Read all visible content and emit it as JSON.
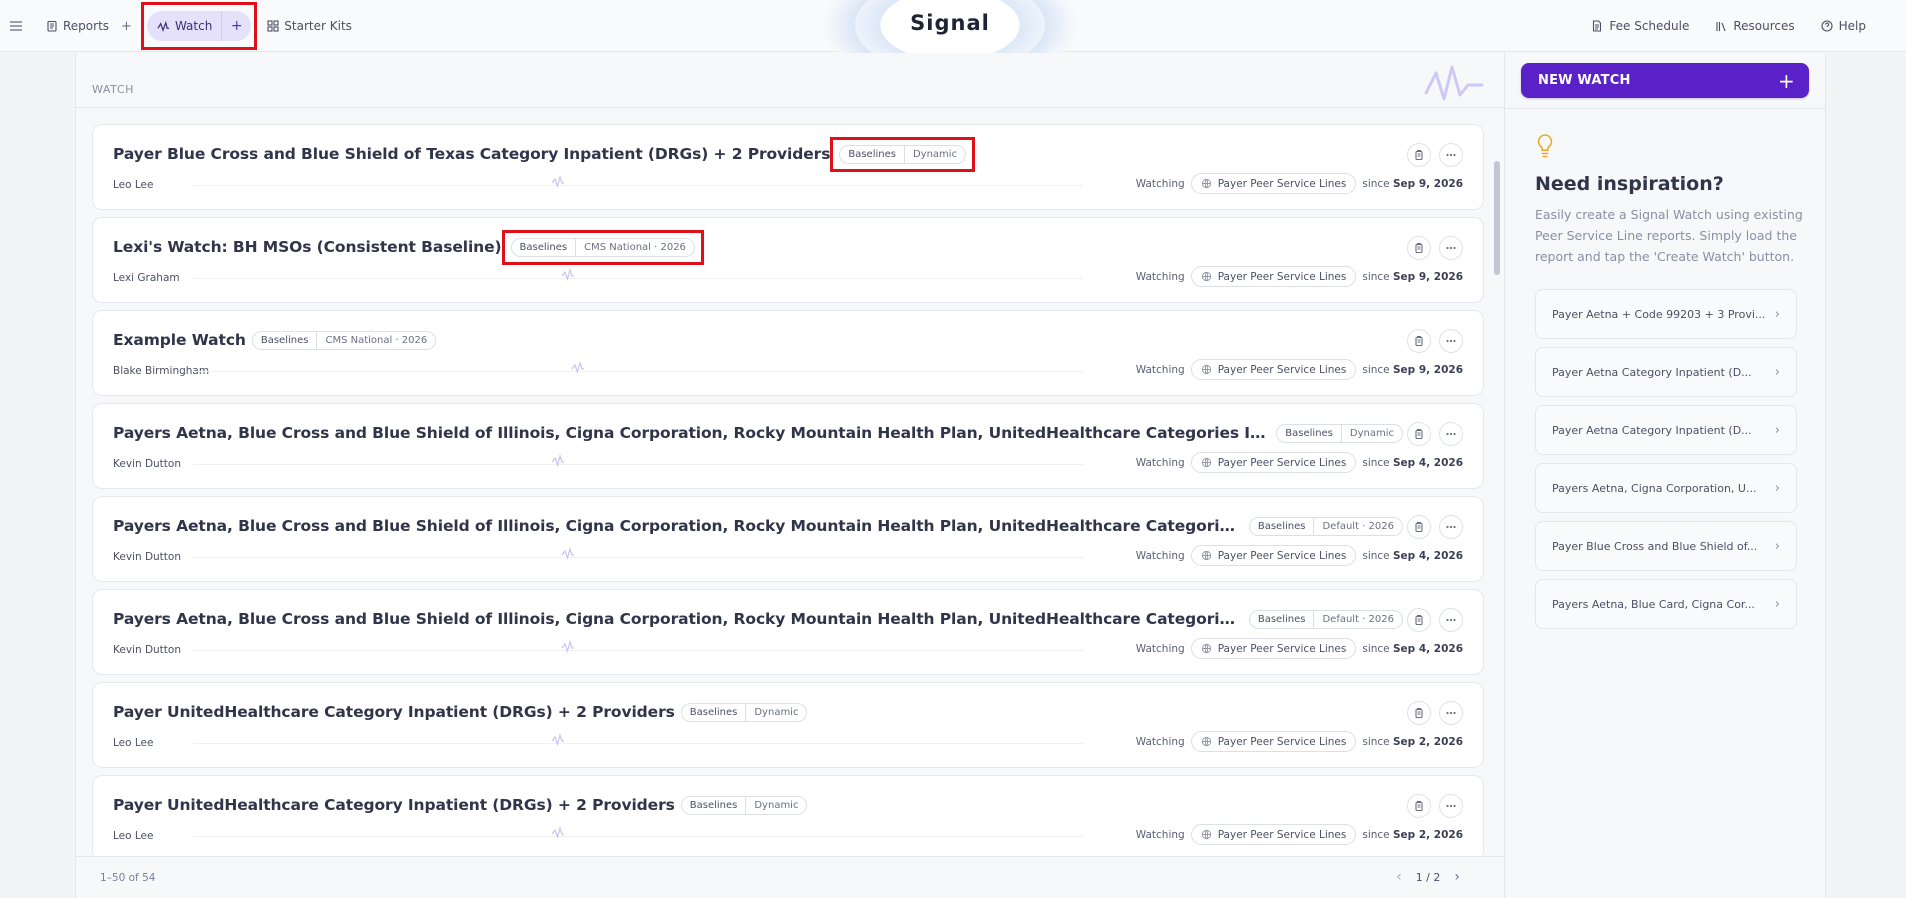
{
  "topbar": {
    "brand": "Signal",
    "reports_label": "Reports",
    "add_label": "+",
    "watch_label": "Watch",
    "starter_kits_label": "Starter Kits",
    "fee_schedule_label": "Fee Schedule",
    "resources_label": "Resources",
    "help_label": "Help"
  },
  "main": {
    "section_title": "WATCH",
    "cards": [
      {
        "title": "Payer Blue Cross and Blue Shield of Texas Category Inpatient (DRGs) + 2 Providers",
        "tag_a": "Baselines",
        "tag_b": "Dynamic",
        "owner": "Leo Lee",
        "status": "Watching",
        "service": "Payer Peer Service Lines",
        "since_prefix": "since",
        "since_date": "Sep 9, 2026"
      },
      {
        "title": "Lexi's Watch: BH MSOs (Consistent Baseline)",
        "tag_a": "Baselines",
        "tag_b": "CMS National · 2026",
        "owner": "Lexi Graham",
        "status": "Watching",
        "service": "Payer Peer Service Lines",
        "since_prefix": "since",
        "since_date": "Sep 9, 2026"
      },
      {
        "title": "Example Watch",
        "tag_a": "Baselines",
        "tag_b": "CMS National · 2026",
        "owner": "Blake Birmingham",
        "status": "Watching",
        "service": "Payer Peer Service Lines",
        "since_prefix": "since",
        "since_date": "Sep 9, 2026"
      },
      {
        "title": "Payers Aetna, Blue Cross and Blue Shield of Illinois, Cigna Corporation, Rocky Mountain Health Plan, UnitedHealthcare Categories Imaging & Radiolog...",
        "tag_a": "Baselines",
        "tag_b": "Dynamic",
        "owner": "Kevin Dutton",
        "status": "Watching",
        "service": "Payer Peer Service Lines",
        "since_prefix": "since",
        "since_date": "Sep 4, 2026"
      },
      {
        "title": "Payers Aetna, Blue Cross and Blue Shield of Illinois, Cigna Corporation, Rocky Mountain Health Plan, UnitedHealthcare Categories Imaging & Radio...",
        "tag_a": "Baselines",
        "tag_b": "Default · 2026",
        "owner": "Kevin Dutton",
        "status": "Watching",
        "service": "Payer Peer Service Lines",
        "since_prefix": "since",
        "since_date": "Sep 4, 2026"
      },
      {
        "title": "Payers Aetna, Blue Cross and Blue Shield of Illinois, Cigna Corporation, Rocky Mountain Health Plan, UnitedHealthcare Categories Imaging & Radio...",
        "tag_a": "Baselines",
        "tag_b": "Default · 2026",
        "owner": "Kevin Dutton",
        "status": "Watching",
        "service": "Payer Peer Service Lines",
        "since_prefix": "since",
        "since_date": "Sep 4, 2026"
      },
      {
        "title": "Payer UnitedHealthcare Category Inpatient (DRGs) + 2 Providers",
        "tag_a": "Baselines",
        "tag_b": "Dynamic",
        "owner": "Leo Lee",
        "status": "Watching",
        "service": "Payer Peer Service Lines",
        "since_prefix": "since",
        "since_date": "Sep 2, 2026"
      },
      {
        "title": "Payer UnitedHealthcare Category Inpatient (DRGs) + 2 Providers",
        "tag_a": "Baselines",
        "tag_b": "Dynamic",
        "owner": "Leo Lee",
        "status": "Watching",
        "service": "Payer Peer Service Lines",
        "since_prefix": "since",
        "since_date": "Sep 2, 2026"
      }
    ]
  },
  "pager": {
    "count": "1–50 of 54",
    "page": "1 / 2"
  },
  "sidebar": {
    "new_watch_label": "NEW WATCH",
    "new_watch_plus": "+",
    "heading": "Need inspiration?",
    "text": "Easily create a Signal Watch using existing Peer Service Line reports. Simply load the report and tap the 'Create Watch' button.",
    "suggestions": [
      "Payer Aetna + Code 99203 + 3 Provi...",
      "Payer Aetna Category Inpatient (D...",
      "Payer Aetna Category Inpatient (D...",
      "Payers Aetna, Cigna Corporation, U...",
      "Payer Blue Cross and Blue Shield of...",
      "Payers Aetna, Blue Card, Cigna Cor..."
    ]
  },
  "colors": {
    "accent": "#5b21c8",
    "highlight": "#e0101a",
    "watch_pill": "#e6e1fb",
    "bulb": "#e8a826"
  },
  "icons": [
    "menu-icon",
    "report-icon",
    "pulse-icon",
    "grid-icon",
    "document-icon",
    "bars-icon",
    "help-icon",
    "trash-icon",
    "more-icon",
    "service-icon",
    "bulb-icon",
    "chevron-right-icon",
    "chevron-left-icon"
  ]
}
